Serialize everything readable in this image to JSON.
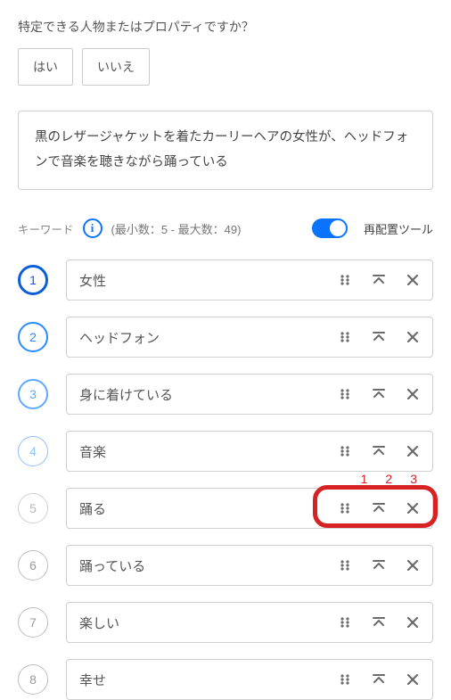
{
  "question": {
    "text": "特定できる人物またはプロパティですか？",
    "yes": "はい",
    "no": "いいえ"
  },
  "description": "黒のレザージャケットを着たカーリーヘアの女性が、ヘッドフォンで音楽を聴きながら踊っている",
  "keywords": {
    "label": "キーワード",
    "range": "(最小数：5 - 最大数：49)",
    "toggle_label": "再配置ツール",
    "toggle_on": true
  },
  "items": [
    {
      "n": "1",
      "text": "女性",
      "style": "num-strong"
    },
    {
      "n": "2",
      "text": "ヘッドフォン",
      "style": "num-med1"
    },
    {
      "n": "3",
      "text": "身に着けている",
      "style": "num-med2"
    },
    {
      "n": "4",
      "text": "音楽",
      "style": "num-med3"
    },
    {
      "n": "5",
      "text": "踊る",
      "style": "num-weak"
    },
    {
      "n": "6",
      "text": "踊っている",
      "style": "num-gray"
    },
    {
      "n": "7",
      "text": "楽しい",
      "style": "num-gray"
    },
    {
      "n": "8",
      "text": "幸せ",
      "style": "num-gray"
    }
  ],
  "annot": {
    "a": "1",
    "b": "2",
    "c": "3"
  }
}
